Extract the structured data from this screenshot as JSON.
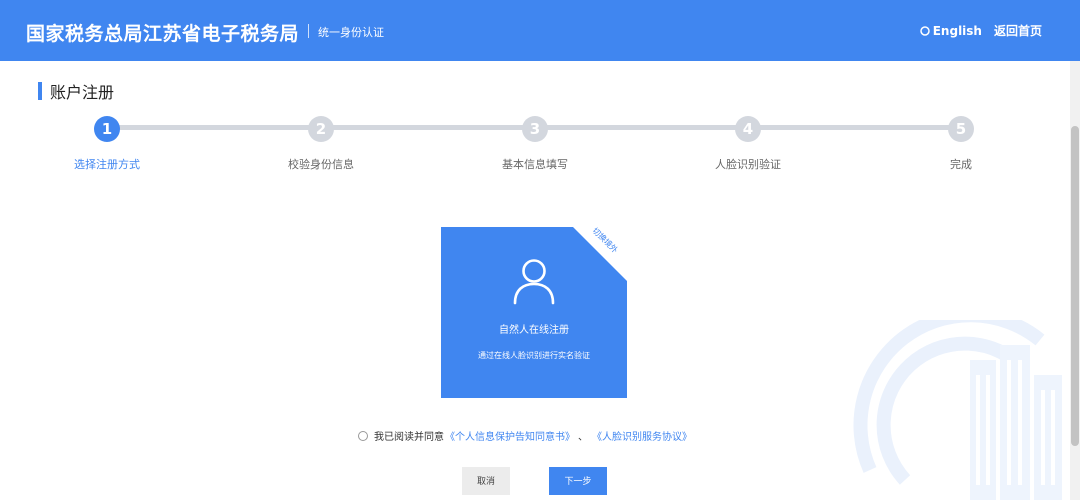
{
  "header": {
    "title": "国家税务总局江苏省电子税务局",
    "subtitle": "统一身份认证",
    "language_label": "English",
    "home_link": "返回首页"
  },
  "section": {
    "title": "账户注册"
  },
  "steps": [
    {
      "number": "1",
      "label": "选择注册方式",
      "active": true
    },
    {
      "number": "2",
      "label": "校验身份信息",
      "active": false
    },
    {
      "number": "3",
      "label": "基本信息填写",
      "active": false
    },
    {
      "number": "4",
      "label": "人脸识别验证",
      "active": false
    },
    {
      "number": "5",
      "label": "完成",
      "active": false
    }
  ],
  "card": {
    "corner_label": "切换境外",
    "icon": "user-icon",
    "title": "自然人在线注册",
    "description": "通过在线人脸识别进行实名验证"
  },
  "agreement": {
    "text": "我已阅读并同意",
    "link1": "《个人信息保护告知同意书》",
    "separator": "、",
    "link2": "《人脸识别服务协议》",
    "checked": false
  },
  "buttons": {
    "cancel": "取消",
    "next": "下一步"
  },
  "colors": {
    "primary": "#4086f0",
    "inactive_step": "#d3d7de"
  }
}
